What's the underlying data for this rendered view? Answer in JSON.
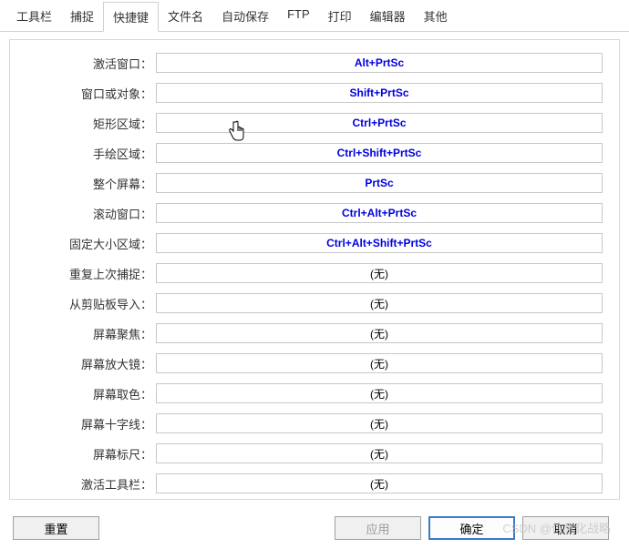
{
  "tabs": {
    "items": [
      {
        "id": "toolbar",
        "label": "工具栏",
        "active": false
      },
      {
        "id": "capture",
        "label": "捕捉",
        "active": false
      },
      {
        "id": "hotkeys",
        "label": "快捷键",
        "active": true
      },
      {
        "id": "filename",
        "label": "文件名",
        "active": false
      },
      {
        "id": "autosave",
        "label": "自动保存",
        "active": false
      },
      {
        "id": "ftp",
        "label": "FTP",
        "active": false
      },
      {
        "id": "print",
        "label": "打印",
        "active": false
      },
      {
        "id": "editor",
        "label": "编辑器",
        "active": false
      },
      {
        "id": "other",
        "label": "其他",
        "active": false
      }
    ]
  },
  "hotkeys": {
    "rows": [
      {
        "label": "激活窗口：",
        "value": "Alt+PrtSc",
        "empty": false
      },
      {
        "label": "窗口或对象：",
        "value": "Shift+PrtSc",
        "empty": false
      },
      {
        "label": "矩形区域：",
        "value": "Ctrl+PrtSc",
        "empty": false
      },
      {
        "label": "手绘区域：",
        "value": "Ctrl+Shift+PrtSc",
        "empty": false
      },
      {
        "label": "整个屏幕：",
        "value": "PrtSc",
        "empty": false
      },
      {
        "label": "滚动窗口：",
        "value": "Ctrl+Alt+PrtSc",
        "empty": false
      },
      {
        "label": "固定大小区域：",
        "value": "Ctrl+Alt+Shift+PrtSc",
        "empty": false
      },
      {
        "label": "重复上次捕捉：",
        "value": "(无)",
        "empty": true
      },
      {
        "label": "从剪贴板导入：",
        "value": "(无)",
        "empty": true
      },
      {
        "label": "屏幕聚焦：",
        "value": "(无)",
        "empty": true
      },
      {
        "label": "屏幕放大镜：",
        "value": "(无)",
        "empty": true
      },
      {
        "label": "屏幕取色：",
        "value": "(无)",
        "empty": true
      },
      {
        "label": "屏幕十字线：",
        "value": "(无)",
        "empty": true
      },
      {
        "label": "屏幕标尺：",
        "value": "(无)",
        "empty": true
      },
      {
        "label": "激活工具栏：",
        "value": "(无)",
        "empty": true
      }
    ]
  },
  "buttons": {
    "reset": "重置",
    "apply": "应用",
    "ok": "确定",
    "cancel": "取消"
  },
  "watermark": "CSDN @信息化战略"
}
